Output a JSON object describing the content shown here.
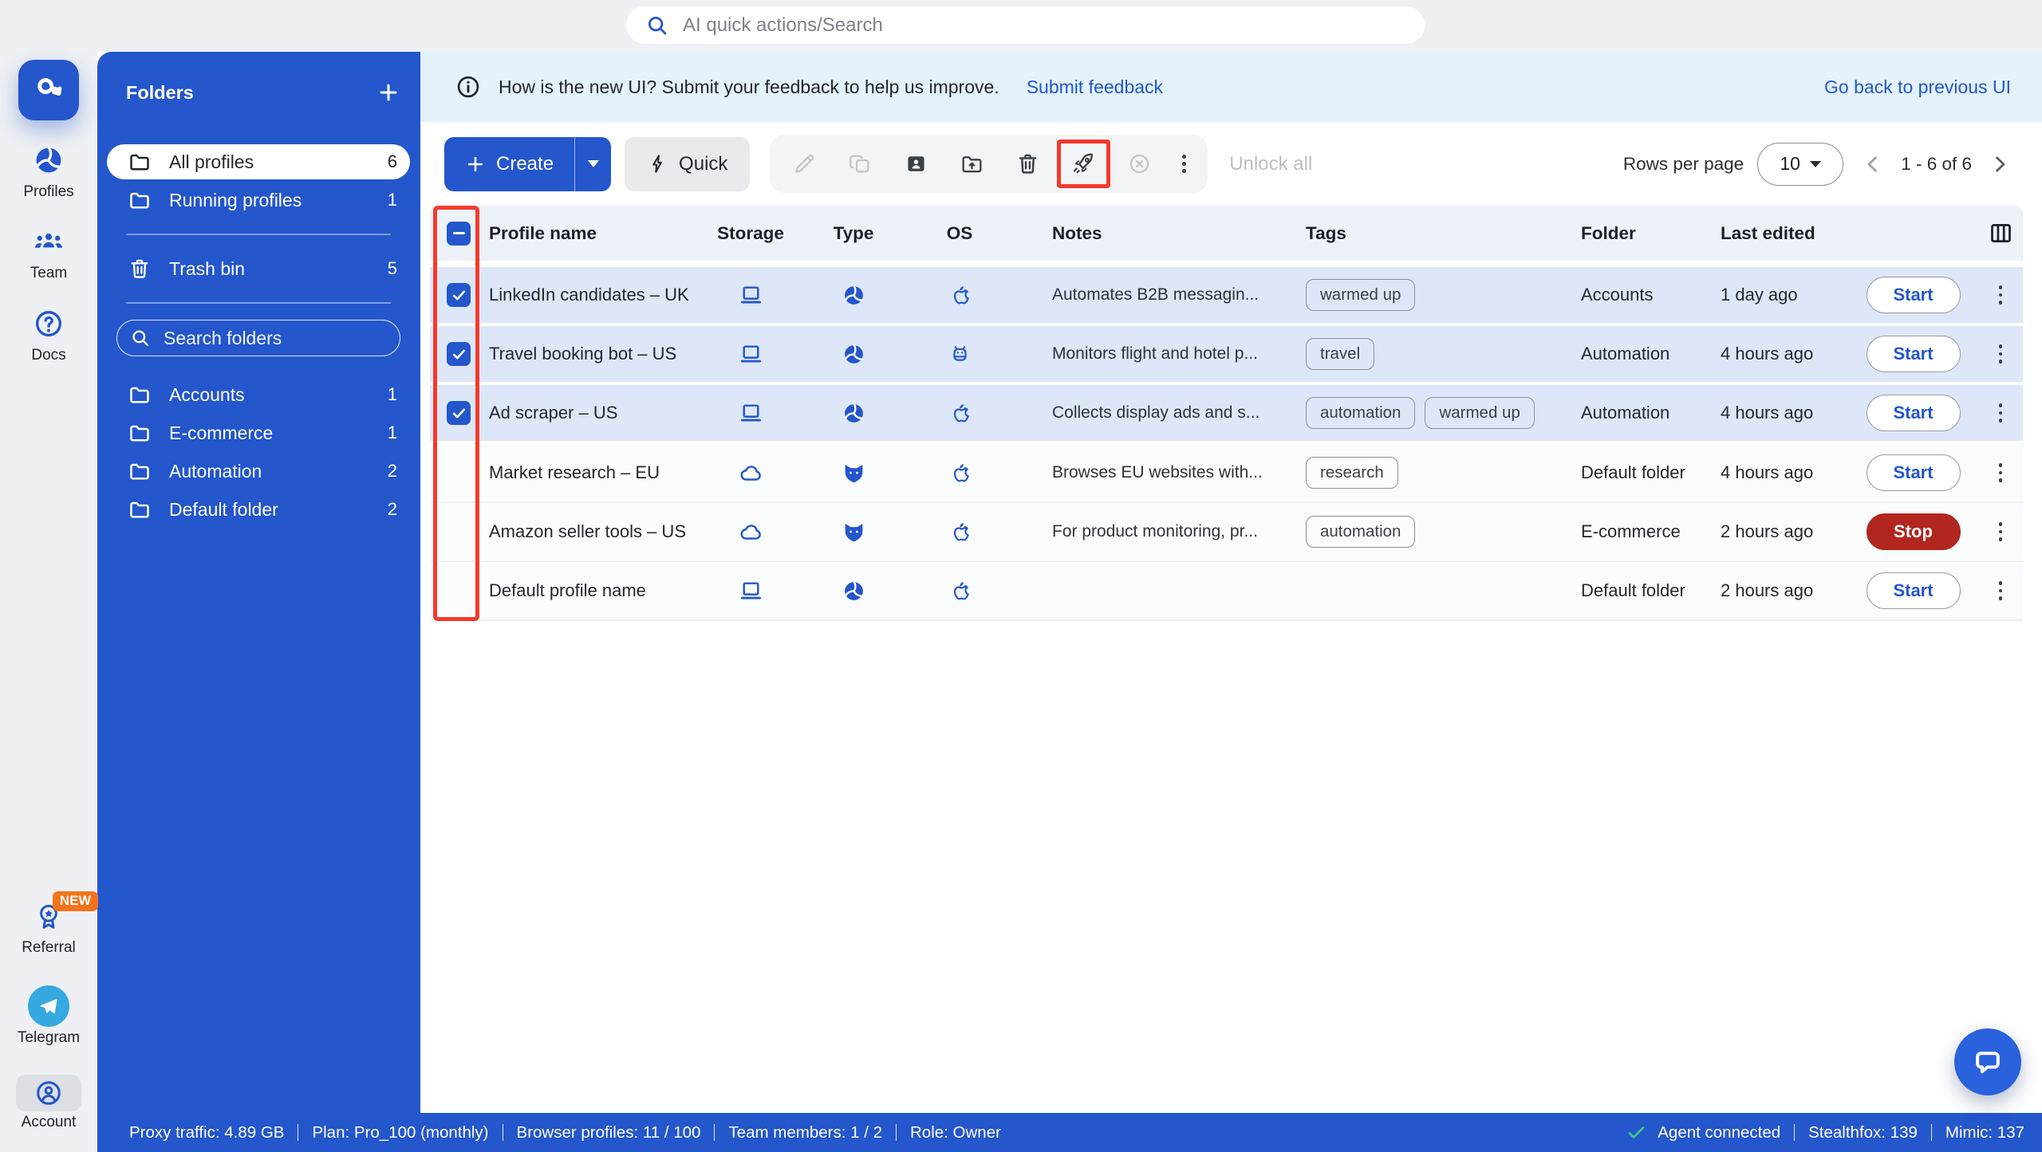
{
  "topbar": {
    "search_placeholder": "AI quick actions/Search"
  },
  "rail": {
    "profiles": "Profiles",
    "team": "Team",
    "docs": "Docs",
    "referral": "Referral",
    "referral_badge": "NEW",
    "telegram": "Telegram",
    "account": "Account"
  },
  "folders": {
    "title": "Folders",
    "pinned": [
      {
        "label": "All profiles",
        "count": "6"
      },
      {
        "label": "Running profiles",
        "count": "1"
      }
    ],
    "trash": {
      "label": "Trash bin",
      "count": "5"
    },
    "search_placeholder": "Search folders",
    "items": [
      {
        "label": "Accounts",
        "count": "1"
      },
      {
        "label": "E-commerce",
        "count": "1"
      },
      {
        "label": "Automation",
        "count": "2"
      },
      {
        "label": "Default folder",
        "count": "2"
      }
    ]
  },
  "banner": {
    "message": "How is the new UI?  Submit your feedback to help us improve.",
    "link": "Submit feedback",
    "right_link": "Go back to previous UI"
  },
  "toolbar": {
    "create": "Create",
    "quick": "Quick",
    "unlock": "Unlock all",
    "rows_per_page_label": "Rows per page",
    "rows_per_page_value": "10",
    "range": "1 - 6 of 6"
  },
  "table": {
    "columns": [
      "Profile name",
      "Storage",
      "Type",
      "OS",
      "Notes",
      "Tags",
      "Folder",
      "Last edited"
    ],
    "rows": [
      {
        "name": "LinkedIn candidates – UK",
        "storage": "local",
        "type": "mimic",
        "os": "macos",
        "notes": "Automates B2B messagin...",
        "tags": [
          "warmed up"
        ],
        "folder": "Accounts",
        "edited": "1 day ago",
        "action": "Start",
        "selected": true
      },
      {
        "name": "Travel booking bot – US",
        "storage": "local",
        "type": "mimic",
        "os": "android",
        "notes": "Monitors flight and hotel p...",
        "tags": [
          "travel"
        ],
        "folder": "Automation",
        "edited": "4 hours ago",
        "action": "Start",
        "selected": true
      },
      {
        "name": "Ad scraper – US",
        "storage": "local",
        "type": "mimic",
        "os": "macos",
        "notes": "Collects display ads and s...",
        "tags": [
          "automation",
          "warmed up"
        ],
        "folder": "Automation",
        "edited": "4 hours ago",
        "action": "Start",
        "selected": true
      },
      {
        "name": "Market research – EU",
        "storage": "cloud",
        "type": "stealthfox",
        "os": "macos",
        "notes": "Browses EU websites with...",
        "tags": [
          "research"
        ],
        "folder": "Default folder",
        "edited": "4 hours ago",
        "action": "Start",
        "selected": false
      },
      {
        "name": "Amazon seller tools – US",
        "storage": "cloud",
        "type": "stealthfox",
        "os": "macos",
        "notes": "For product monitoring, pr...",
        "tags": [
          "automation"
        ],
        "folder": "E-commerce",
        "edited": "2 hours ago",
        "action": "Stop",
        "selected": false
      },
      {
        "name": "Default profile name",
        "storage": "local",
        "type": "mimic",
        "os": "macos",
        "notes": "",
        "tags": [],
        "folder": "Default folder",
        "edited": "2 hours ago",
        "action": "Start",
        "selected": false
      }
    ]
  },
  "statusbar": {
    "left": [
      "Proxy traffic: 4.89 GB",
      "Plan: Pro_100 (monthly)",
      "Browser profiles: 11 / 100",
      "Team members: 1 / 2",
      "Role: Owner"
    ],
    "agent_status": "Agent connected",
    "right": [
      "Stealthfox: 139",
      "Mimic: 137"
    ]
  },
  "colors": {
    "accent_blue": "#2456cc",
    "selected_row": "#dde7f8",
    "banner_bg": "#e3f2fb",
    "annotation_red": "#f23b2d",
    "stop_red": "#b1261e",
    "new_badge_orange": "#f4731c",
    "telegram_blue": "#35a9e0",
    "success_green": "#3ecb82"
  }
}
